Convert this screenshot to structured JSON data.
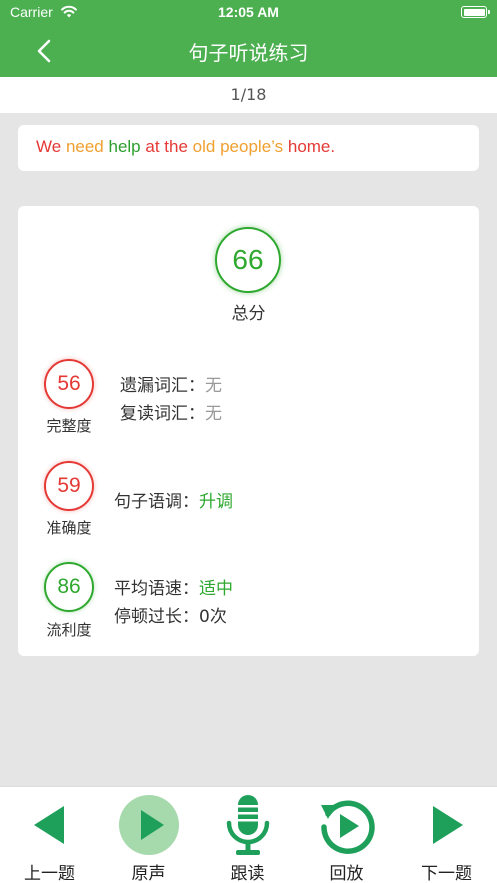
{
  "status_bar": {
    "carrier": "Carrier",
    "time": "12:05 AM"
  },
  "nav": {
    "title": "句子听说练习"
  },
  "progress": {
    "text": "1/18"
  },
  "sentence": {
    "words": [
      {
        "text": "We",
        "color": "red"
      },
      {
        "text": "need",
        "color": "orange"
      },
      {
        "text": "help",
        "color": "green"
      },
      {
        "text": "at",
        "color": "red"
      },
      {
        "text": "the",
        "color": "red"
      },
      {
        "text": "old",
        "color": "orange"
      },
      {
        "text": "people’s",
        "color": "orange"
      },
      {
        "text": "home.",
        "color": "red"
      }
    ]
  },
  "score": {
    "total": {
      "value": "66",
      "label": "总分"
    },
    "completeness": {
      "value": "56",
      "label": "完整度",
      "missing_label": "遗漏词汇：",
      "missing_value": "无",
      "repeat_label": "复读词汇：",
      "repeat_value": "无"
    },
    "accuracy": {
      "value": "59",
      "label": "准确度",
      "intonation_label": "句子语调：",
      "intonation_value": "升调"
    },
    "fluency": {
      "value": "86",
      "label": "流利度",
      "speed_label": "平均语速：",
      "speed_value": "适中",
      "pause_label": "停顿过长：",
      "pause_value": "0次"
    }
  },
  "bottom": {
    "prev_label": "上一题",
    "original_label": "原声",
    "follow_label": "跟读",
    "playback_label": "回放",
    "next_label": "下一题"
  },
  "colors": {
    "accent": "#4caf50",
    "red": "#e53935",
    "orange": "#f0a030",
    "green": "#2e9e2e",
    "icon_green": "#1ea05a"
  }
}
